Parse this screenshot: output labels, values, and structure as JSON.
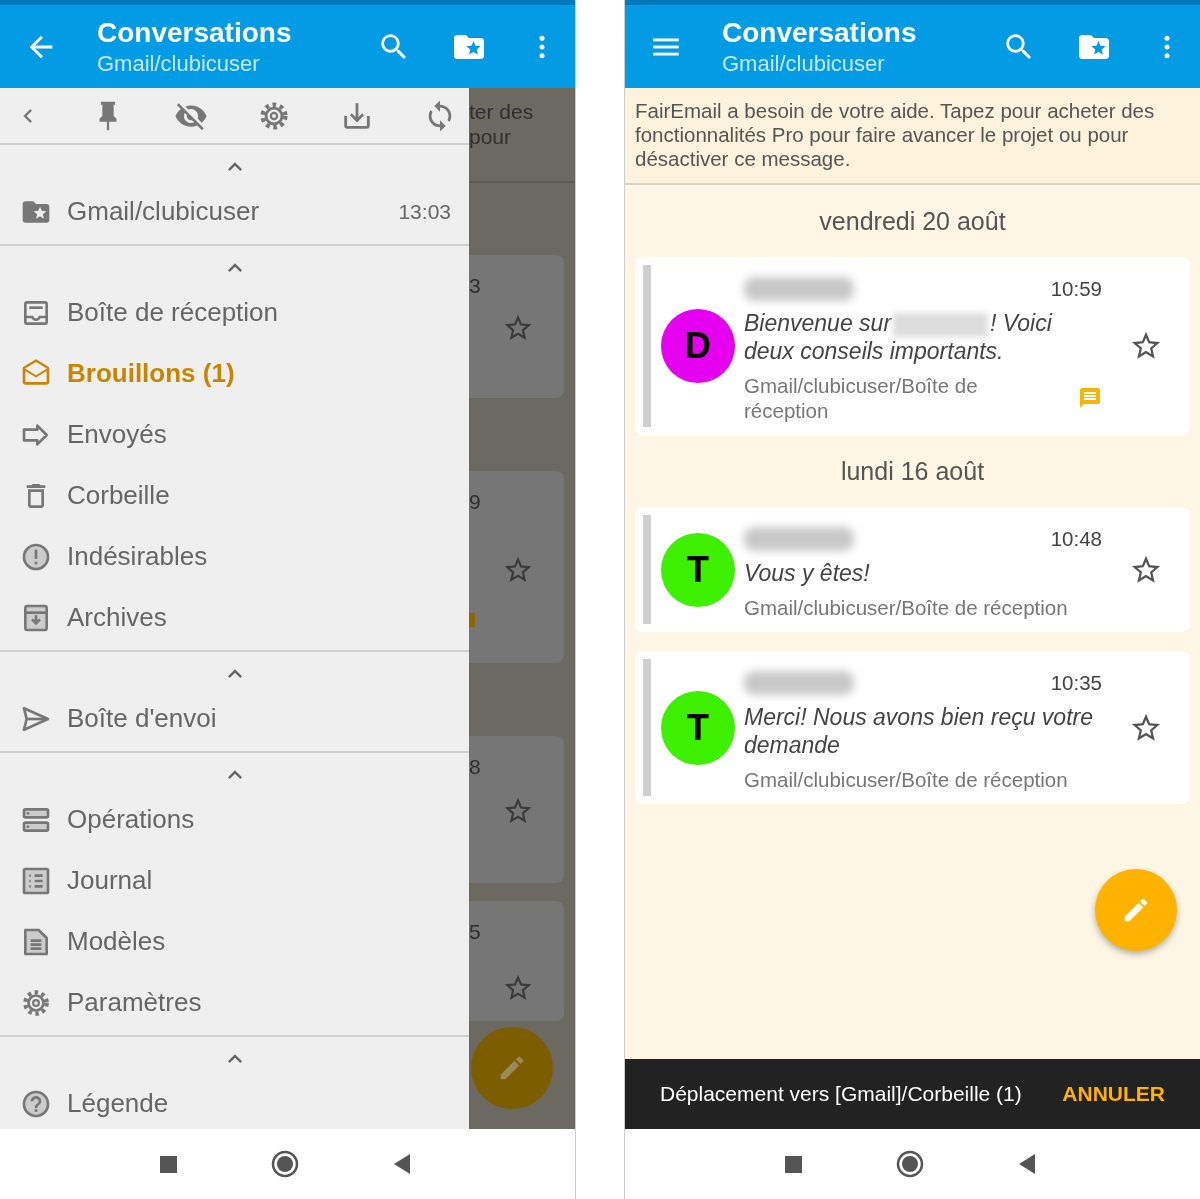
{
  "left_screen": {
    "app_bar": {
      "title": "Conversations",
      "subtitle": "Gmail/clubicuser"
    },
    "drawer": {
      "sections": [
        {
          "expanded": true,
          "items": [
            {
              "label": "Gmail/clubicuser",
              "time": "13:03",
              "highlighted": false
            }
          ]
        },
        {
          "expanded": true,
          "items": [
            {
              "label": "Boîte de réception",
              "highlighted": false
            },
            {
              "label": "Brouillons (1)",
              "highlighted": true
            },
            {
              "label": "Envoyés",
              "highlighted": false
            },
            {
              "label": "Corbeille",
              "highlighted": false
            },
            {
              "label": "Indésirables",
              "highlighted": false
            },
            {
              "label": "Archives",
              "highlighted": false
            }
          ]
        },
        {
          "expanded": true,
          "items": [
            {
              "label": "Boîte d'envoi",
              "highlighted": false
            }
          ]
        },
        {
          "expanded": true,
          "items": [
            {
              "label": "Opérations",
              "highlighted": false
            },
            {
              "label": "Journal",
              "highlighted": false
            },
            {
              "label": "Modèles",
              "highlighted": false
            },
            {
              "label": "Paramètres",
              "highlighted": false
            }
          ]
        },
        {
          "expanded": true,
          "items": [
            {
              "label": "Légende",
              "highlighted": false
            }
          ]
        }
      ]
    },
    "background_peek": {
      "banner_lines": [
        "ter des",
        "pour"
      ],
      "cards": [
        {
          "time_fragment": "3",
          "starred": false,
          "has_note": false
        },
        {
          "time_fragment": "9",
          "starred": false,
          "has_note": true
        },
        {
          "time_fragment": "8",
          "starred": false,
          "has_note": false
        },
        {
          "time_fragment": "5",
          "starred": false,
          "has_note": false
        }
      ]
    }
  },
  "right_screen": {
    "app_bar": {
      "title": "Conversations",
      "subtitle": "Gmail/clubicuser"
    },
    "banner": "FairEmail a besoin de votre aide. Tapez pour acheter des fonctionnalités Pro pour faire avancer le projet ou pour désactiver ce message.",
    "groups": [
      {
        "date": "vendredi 20 août",
        "messages": [
          {
            "avatar_letter": "D",
            "color": "#e600f0",
            "time": "10:59",
            "subject_parts": [
              "Bienvenue sur",
              "! Voici deux conseils importants."
            ],
            "folder": "Gmail/clubicuser/Boîte de réception",
            "starred": false,
            "has_note": true
          }
        ]
      },
      {
        "date": "lundi 16 août",
        "messages": [
          {
            "avatar_letter": "T",
            "color": "#3cf000",
            "time": "10:48",
            "subject_parts": [
              "Vous y êtes!"
            ],
            "folder": "Gmail/clubicuser/Boîte de réception",
            "starred": false,
            "has_note": false
          },
          {
            "avatar_letter": "T",
            "color": "#3cf000",
            "time": "10:35",
            "subject_parts": [
              "Merci! Nous avons bien reçu votre demande"
            ],
            "folder": "Gmail/clubicuser/Boîte de réception",
            "starred": false,
            "has_note": false
          }
        ]
      }
    ],
    "snackbar": {
      "message": "Déplacement vers [Gmail]/Corbeille (1)",
      "action": "ANNULER"
    }
  }
}
